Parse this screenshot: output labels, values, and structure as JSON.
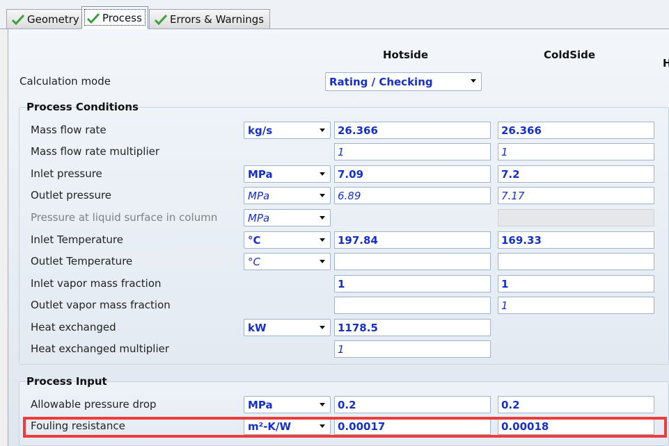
{
  "tabs": [
    {
      "label": "Geometry",
      "icon": "check-icon",
      "active": false
    },
    {
      "label": "Process",
      "icon": "check-icon",
      "active": true
    },
    {
      "label": "Errors & Warnings",
      "icon": "check-icon",
      "active": false
    }
  ],
  "columns": {
    "hotside": "Hotside",
    "coldside": "ColdSide",
    "third_partial": "H"
  },
  "calculation_mode": {
    "label": "Calculation mode",
    "value": "Rating / Checking"
  },
  "process_conditions": {
    "title": "Process Conditions",
    "rows": [
      {
        "label": "Mass flow rate",
        "unit": "kg/s",
        "hot": "26.366",
        "cold": "26.366"
      },
      {
        "label": "Mass flow rate multiplier",
        "unit": "",
        "hot": "1",
        "cold": "1"
      },
      {
        "label": "Inlet pressure",
        "unit": "MPa",
        "hot": "7.09",
        "cold": "7.2"
      },
      {
        "label": "Outlet pressure",
        "unit": "MPa",
        "hot": "6.89",
        "cold": "7.17"
      },
      {
        "label": "Pressure at liquid surface in column",
        "unit": "MPa",
        "hot": "",
        "cold": ""
      },
      {
        "label": "Inlet Temperature",
        "unit": "°C",
        "hot": "197.84",
        "cold": "169.33"
      },
      {
        "label": "Outlet Temperature",
        "unit": "°C",
        "hot": "",
        "cold": ""
      },
      {
        "label": "Inlet vapor mass fraction",
        "unit": "",
        "hot": "1",
        "cold": "1"
      },
      {
        "label": "Outlet vapor mass fraction",
        "unit": "",
        "hot": "",
        "cold": "1"
      },
      {
        "label": "Heat exchanged",
        "unit": "kW",
        "hot": "1178.5",
        "cold": ""
      },
      {
        "label": "Heat exchanged multiplier",
        "unit": "",
        "hot": "1",
        "cold": ""
      }
    ]
  },
  "process_input": {
    "title": "Process Input",
    "rows": [
      {
        "label": "Allowable pressure drop",
        "unit": "MPa",
        "hot": "0.2",
        "cold": "0.2"
      },
      {
        "label": "Fouling resistance",
        "unit": "m²-K/W",
        "hot": "0.00017",
        "cold": "0.00018"
      }
    ]
  },
  "colors": {
    "value_text": "#1530c8",
    "highlight": "#ee3b3b"
  }
}
